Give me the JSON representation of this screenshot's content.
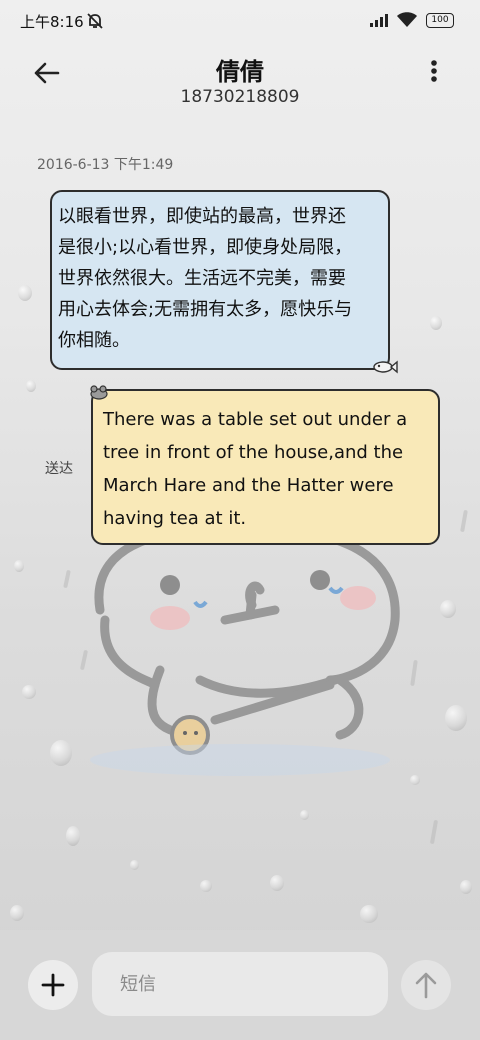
{
  "status_bar": {
    "time": "上午8:16",
    "battery": "100",
    "icons": [
      "bell-muted-icon",
      "signal-icon",
      "wifi-icon",
      "battery-icon"
    ]
  },
  "header": {
    "contact_name": "倩倩",
    "phone_number": "18730218809",
    "icons": [
      "back-arrow-icon",
      "more-vertical-icon"
    ]
  },
  "conversation": {
    "timestamp": "2016-6-13 下午1:49",
    "messages": [
      {
        "lines": [
          "以眼看世界，即使站的最高，世界还",
          "是很小;以心看世界，即使身处局限，",
          "世界依然很大。生活远不完美，需要",
          "用心去体会;无需拥有太多，愿快乐与",
          "你相随。"
        ]
      },
      {
        "lines": [
          "There was a table set out under a",
          "tree in front of the house,and the",
          "March Hare and the Hatter were",
          "having tea at it."
        ],
        "status": "送达"
      }
    ]
  },
  "composer": {
    "placeholder": "短信",
    "icons": [
      "plus-icon",
      "send-arrow-icon"
    ]
  },
  "colors": {
    "sent_bubble": "#d6e6f2",
    "received_bubble": "#f9e9b8",
    "bubble_border": "#2d2d2d",
    "bottom_bar": "#d7d7d7"
  }
}
